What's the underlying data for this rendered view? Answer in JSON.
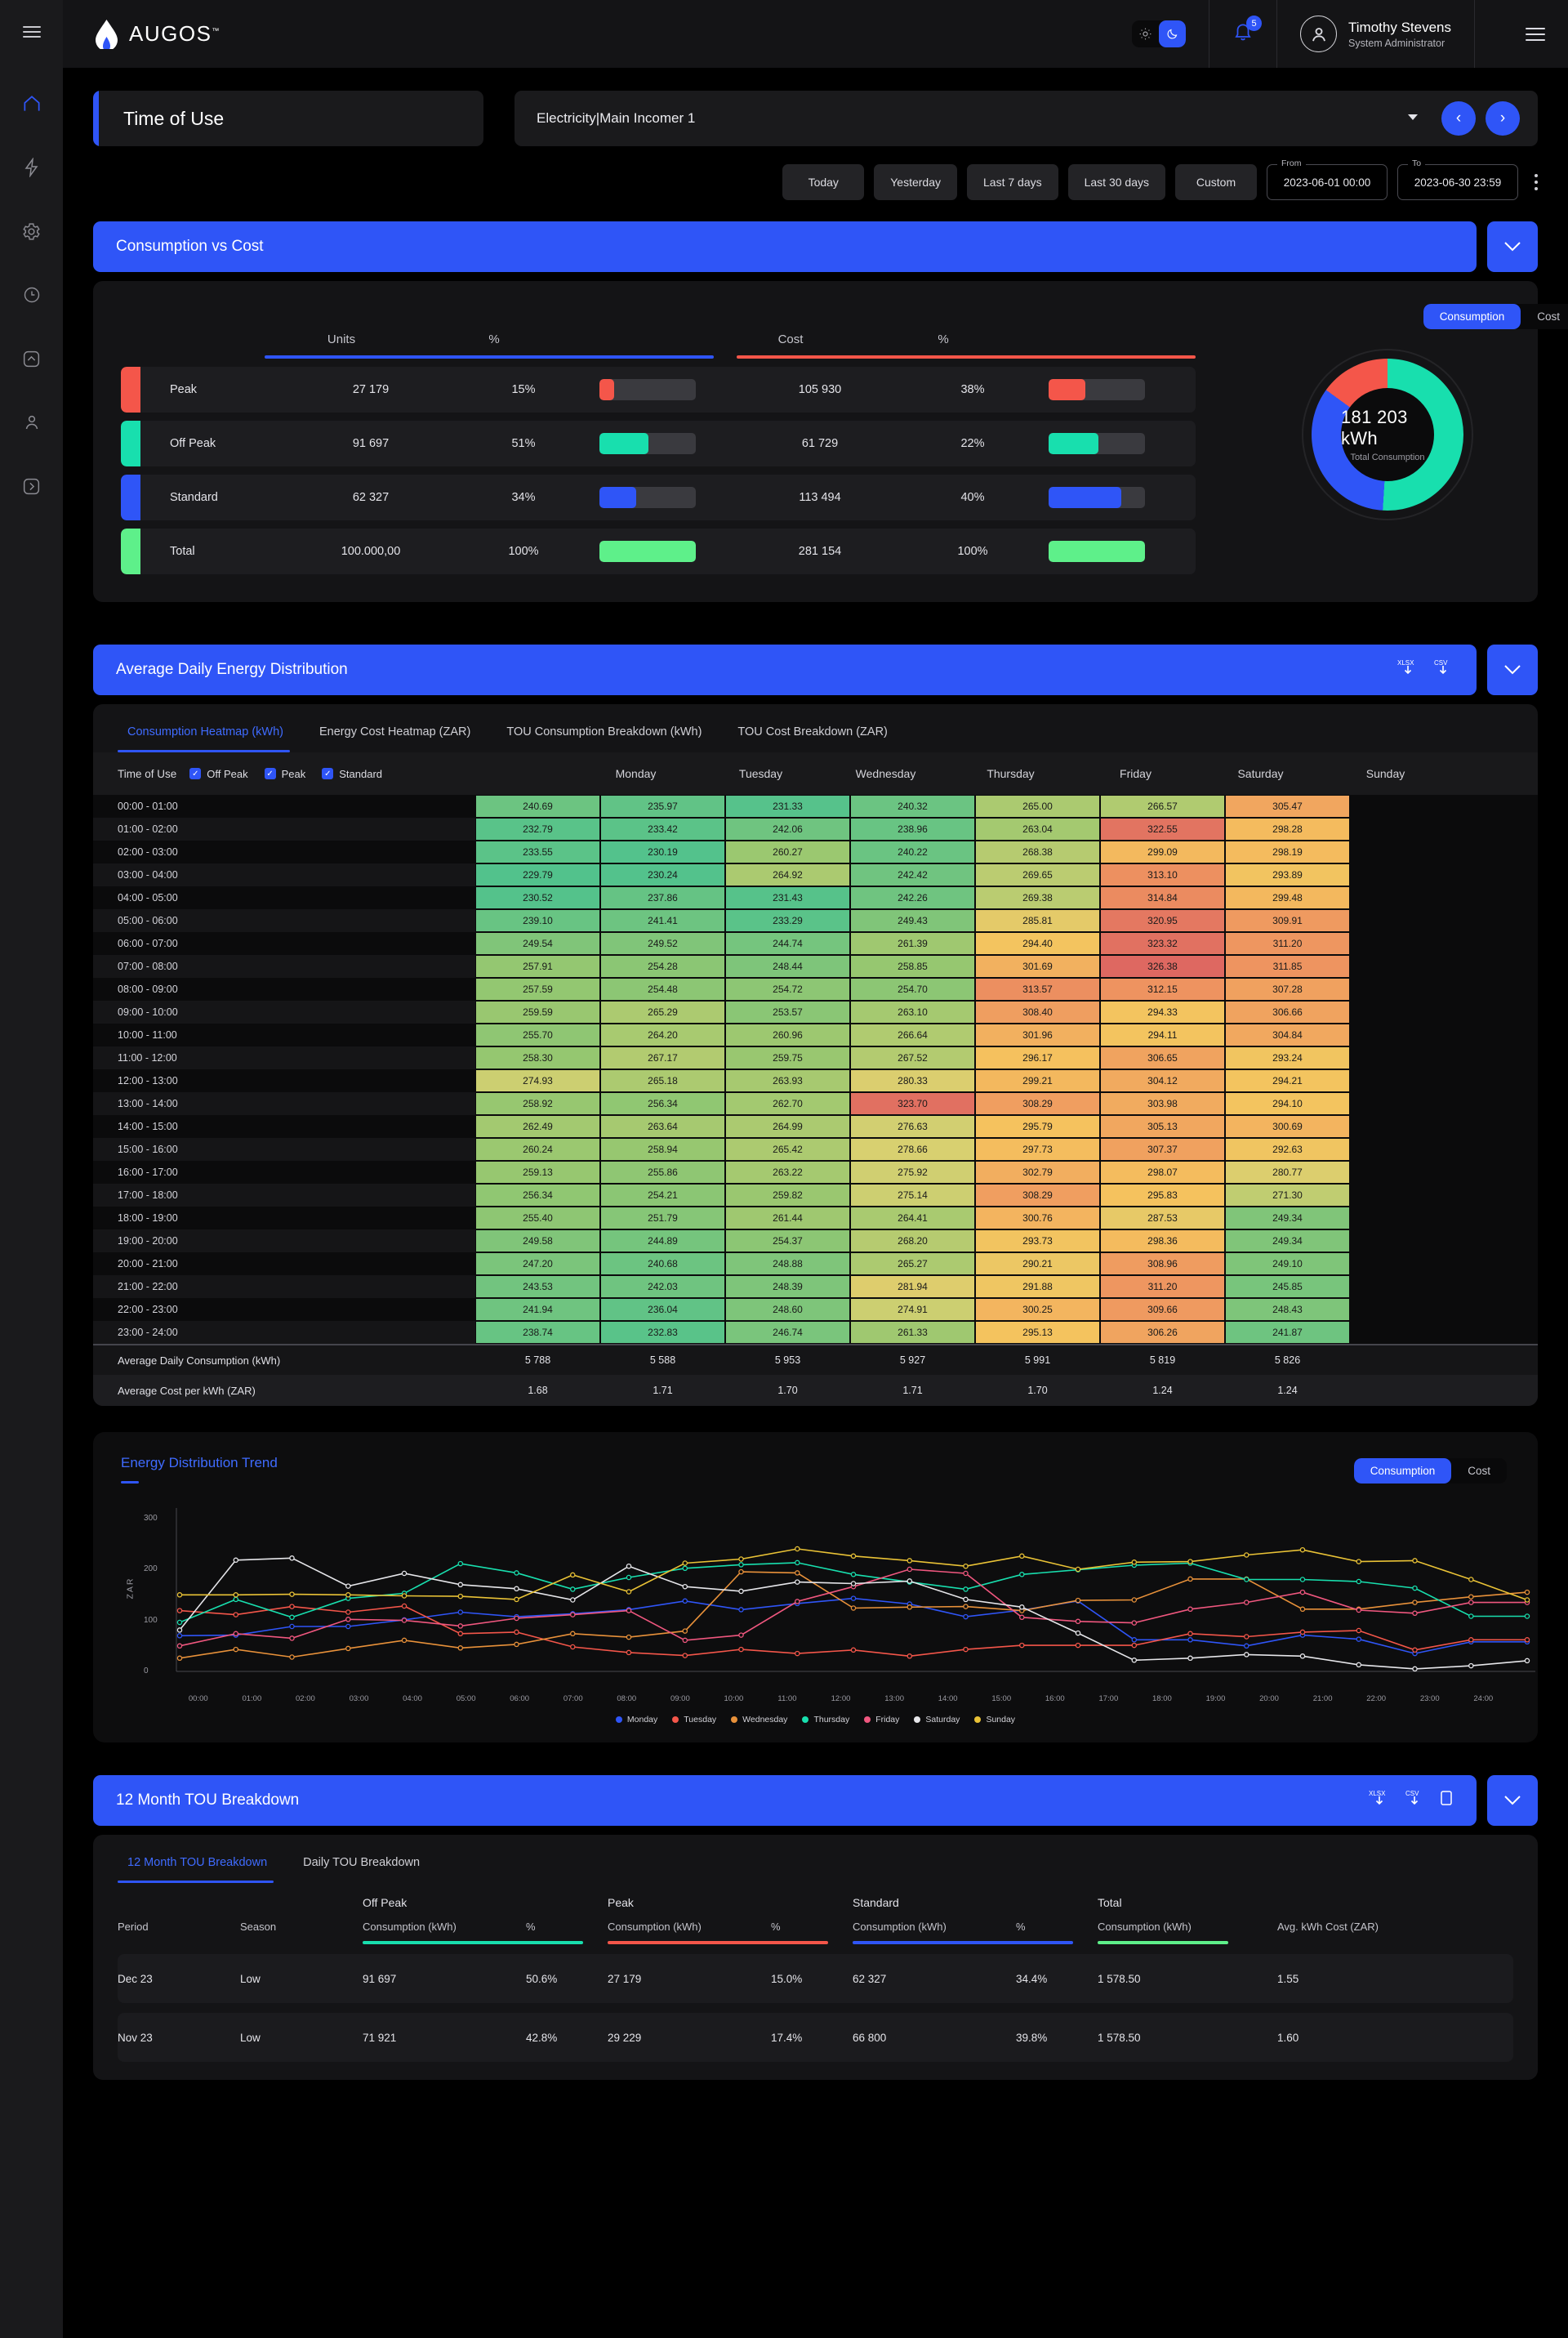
{
  "brand": {
    "name": "AUGOS",
    "tm": "™"
  },
  "topbar": {
    "theme_light_icon": "sun-icon",
    "theme_dark_icon": "moon-icon",
    "notifications_count": "5",
    "user_name": "Timothy Stevens",
    "user_role": "System Administrator"
  },
  "header": {
    "page_title": "Time of Use",
    "selector_value": "Electricity|Main Incomer 1",
    "prev_label": "‹",
    "next_label": "›"
  },
  "date_range": {
    "presets": [
      "Today",
      "Yesterday",
      "Last 7 days",
      "Last 30 days",
      "Custom"
    ],
    "from_label": "From",
    "from_value": "2023-06-01  00:00",
    "to_label": "To",
    "to_value": "2023-06-30  23:59"
  },
  "consumption_vs_cost": {
    "section_title": "Consumption vs Cost",
    "headers": {
      "units": "Units",
      "units_pct": "%",
      "cost": "Cost",
      "cost_pct": "%"
    },
    "toggle": {
      "consumption": "Consumption",
      "cost": "Cost",
      "selected": "Consumption"
    },
    "rows": [
      {
        "name": "Peak",
        "units": "27 179",
        "units_pct": "15%",
        "units_bar": 15,
        "cost": "105 930",
        "cost_pct": "38%",
        "cost_bar": 38,
        "color": "#f4564a"
      },
      {
        "name": "Off Peak",
        "units": "91 697",
        "units_pct": "51%",
        "units_bar": 51,
        "cost": "61 729",
        "cost_pct": "22%",
        "cost_bar": 52,
        "color": "#18dfae"
      },
      {
        "name": "Standard",
        "units": "62 327",
        "units_pct": "34%",
        "units_bar": 38,
        "cost": "113 494",
        "cost_pct": "40%",
        "cost_bar": 75,
        "color": "#2f55f7"
      },
      {
        "name": "Total",
        "units": "100.000,00",
        "units_pct": "100%",
        "units_bar": 100,
        "cost": "281 154",
        "cost_pct": "100%",
        "cost_bar": 100,
        "color": "#5ef08a"
      }
    ],
    "donut": {
      "center_value": "181 203 kWh",
      "center_label": "Total Consumption",
      "segments": [
        {
          "name": "Off Peak",
          "pct": 51,
          "color": "#18dfae"
        },
        {
          "name": "Standard",
          "pct": 34,
          "color": "#2f55f7"
        },
        {
          "name": "Peak",
          "pct": 15,
          "color": "#f4564a"
        }
      ]
    }
  },
  "heatmap_section": {
    "section_title": "Average Daily Energy Distribution",
    "export_xlsx": "XLSX",
    "export_csv": "CSV",
    "tabs": [
      "Consumption Heatmap (kWh)",
      "Energy Cost Heatmap (ZAR)",
      "TOU Consumption Breakdown (kWh)",
      "TOU Cost Breakdown (ZAR)"
    ],
    "active_tab": "Consumption Heatmap (kWh)",
    "tou_filter_label": "Time of Use",
    "tou_filters": [
      "Off Peak",
      "Peak",
      "Standard"
    ],
    "days": [
      "Monday",
      "Tuesday",
      "Wednesday",
      "Thursday",
      "Friday",
      "Saturday",
      "Sunday"
    ],
    "rows": [
      {
        "time": "00:00 - 01:00",
        "values": [
          "240.69",
          "235.97",
          "231.33",
          "240.32",
          "265.00",
          "266.57",
          "305.47"
        ]
      },
      {
        "time": "01:00 - 02:00",
        "values": [
          "232.79",
          "233.42",
          "242.06",
          "238.96",
          "263.04",
          "322.55",
          "298.28"
        ]
      },
      {
        "time": "02:00 - 03:00",
        "values": [
          "233.55",
          "230.19",
          "260.27",
          "240.22",
          "268.38",
          "299.09",
          "298.19"
        ]
      },
      {
        "time": "03:00 - 04:00",
        "values": [
          "229.79",
          "230.24",
          "264.92",
          "242.42",
          "269.65",
          "313.10",
          "293.89"
        ]
      },
      {
        "time": "04:00 - 05:00",
        "values": [
          "230.52",
          "237.86",
          "231.43",
          "242.26",
          "269.38",
          "314.84",
          "299.48"
        ]
      },
      {
        "time": "05:00 - 06:00",
        "values": [
          "239.10",
          "241.41",
          "233.29",
          "249.43",
          "285.81",
          "320.95",
          "309.91"
        ]
      },
      {
        "time": "06:00 - 07:00",
        "values": [
          "249.54",
          "249.52",
          "244.74",
          "261.39",
          "294.40",
          "323.32",
          "311.20"
        ]
      },
      {
        "time": "07:00 - 08:00",
        "values": [
          "257.91",
          "254.28",
          "248.44",
          "258.85",
          "301.69",
          "326.38",
          "311.85"
        ]
      },
      {
        "time": "08:00 - 09:00",
        "values": [
          "257.59",
          "254.48",
          "254.72",
          "254.70",
          "313.57",
          "312.15",
          "307.28"
        ]
      },
      {
        "time": "09:00 - 10:00",
        "values": [
          "259.59",
          "265.29",
          "253.57",
          "263.10",
          "308.40",
          "294.33",
          "306.66"
        ]
      },
      {
        "time": "10:00 - 11:00",
        "values": [
          "255.70",
          "264.20",
          "260.96",
          "266.64",
          "301.96",
          "294.11",
          "304.84"
        ]
      },
      {
        "time": "11:00 - 12:00",
        "values": [
          "258.30",
          "267.17",
          "259.75",
          "267.52",
          "296.17",
          "306.65",
          "293.24"
        ]
      },
      {
        "time": "12:00 - 13:00",
        "values": [
          "274.93",
          "265.18",
          "263.93",
          "280.33",
          "299.21",
          "304.12",
          "294.21"
        ]
      },
      {
        "time": "13:00 - 14:00",
        "values": [
          "258.92",
          "256.34",
          "262.70",
          "323.70",
          "308.29",
          "303.98",
          "294.10"
        ]
      },
      {
        "time": "14:00 - 15:00",
        "values": [
          "262.49",
          "263.64",
          "264.99",
          "276.63",
          "295.79",
          "305.13",
          "300.69"
        ]
      },
      {
        "time": "15:00 - 16:00",
        "values": [
          "260.24",
          "258.94",
          "265.42",
          "278.66",
          "297.73",
          "307.37",
          "292.63"
        ]
      },
      {
        "time": "16:00 - 17:00",
        "values": [
          "259.13",
          "255.86",
          "263.22",
          "275.92",
          "302.79",
          "298.07",
          "280.77"
        ]
      },
      {
        "time": "17:00 - 18:00",
        "values": [
          "256.34",
          "254.21",
          "259.82",
          "275.14",
          "308.29",
          "295.83",
          "271.30"
        ]
      },
      {
        "time": "18:00 - 19:00",
        "values": [
          "255.40",
          "251.79",
          "261.44",
          "264.41",
          "300.76",
          "287.53",
          "249.34"
        ]
      },
      {
        "time": "19:00 - 20:00",
        "values": [
          "249.58",
          "244.89",
          "254.37",
          "268.20",
          "293.73",
          "298.36",
          "249.34"
        ]
      },
      {
        "time": "20:00 - 21:00",
        "values": [
          "247.20",
          "240.68",
          "248.88",
          "265.27",
          "290.21",
          "308.96",
          "249.10"
        ]
      },
      {
        "time": "21:00 - 22:00",
        "values": [
          "243.53",
          "242.03",
          "248.39",
          "281.94",
          "291.88",
          "311.20",
          "245.85"
        ]
      },
      {
        "time": "22:00 - 23:00",
        "values": [
          "241.94",
          "236.04",
          "248.60",
          "274.91",
          "300.25",
          "309.66",
          "248.43"
        ]
      },
      {
        "time": "23:00 - 24:00",
        "values": [
          "238.74",
          "232.83",
          "246.74",
          "261.33",
          "295.13",
          "306.26",
          "241.87"
        ]
      }
    ],
    "summary": [
      {
        "label": "Average Daily Consumption (kWh)",
        "values": [
          "5 788",
          "5 588",
          "5 953",
          "5 927",
          "5 991",
          "5 819",
          "5 826"
        ]
      },
      {
        "label": "Average Cost per kWh (ZAR)",
        "values": [
          "1.68",
          "1.71",
          "1.70",
          "1.71",
          "1.70",
          "1.24",
          "1.24"
        ]
      }
    ]
  },
  "chart_data": {
    "type": "line",
    "title": "Energy Distribution Trend",
    "xlabel": "",
    "ylabel": "ZAR",
    "ylim": [
      0,
      320
    ],
    "yticks": [
      0,
      100,
      200,
      300
    ],
    "grid": false,
    "legend_position": "bottom",
    "toggle": {
      "consumption": "Consumption",
      "cost": "Cost",
      "selected": "Consumption"
    },
    "x": [
      "00:00",
      "01:00",
      "02:00",
      "03:00",
      "04:00",
      "05:00",
      "06:00",
      "07:00",
      "08:00",
      "09:00",
      "10:00",
      "11:00",
      "12:00",
      "13:00",
      "14:00",
      "15:00",
      "16:00",
      "17:00",
      "18:00",
      "19:00",
      "20:00",
      "21:00",
      "22:00",
      "23:00",
      "24:00"
    ],
    "series": [
      {
        "name": "Monday",
        "color": "#2f55f7",
        "values": [
          70,
          71,
          88,
          88,
          101,
          116,
          107,
          113,
          121,
          138,
          121,
          133,
          143,
          132,
          107,
          120,
          138,
          62,
          62,
          50,
          71,
          63,
          35,
          58,
          58
        ]
      },
      {
        "name": "Tuesday",
        "color": "#f4564a",
        "values": [
          119,
          111,
          127,
          116,
          128,
          74,
          77,
          48,
          37,
          31,
          43,
          35,
          42,
          30,
          43,
          51,
          51,
          51,
          74,
          68,
          77,
          80,
          42,
          62,
          62
        ]
      },
      {
        "name": "Wednesday",
        "color": "#e8913a",
        "values": [
          26,
          43,
          28,
          45,
          61,
          46,
          53,
          74,
          67,
          79,
          195,
          193,
          124,
          126,
          127,
          119,
          139,
          140,
          181,
          181,
          122,
          122,
          135,
          146,
          155
        ]
      },
      {
        "name": "Thursday",
        "color": "#18dfae",
        "values": [
          96,
          141,
          106,
          143,
          153,
          211,
          193,
          161,
          184,
          202,
          209,
          213,
          190,
          175,
          161,
          190,
          199,
          208,
          212,
          180,
          180,
          176,
          163,
          108,
          108
        ]
      },
      {
        "name": "Friday",
        "color": "#f0577f",
        "values": [
          50,
          74,
          65,
          102,
          100,
          89,
          104,
          111,
          119,
          61,
          71,
          137,
          166,
          200,
          192,
          106,
          98,
          95,
          122,
          135,
          155,
          120,
          114,
          135,
          135
        ]
      },
      {
        "name": "Saturday",
        "color": "#e6e6ea",
        "values": [
          81,
          218,
          222,
          167,
          192,
          170,
          162,
          140,
          206,
          166,
          157,
          175,
          172,
          177,
          141,
          126,
          75,
          22,
          26,
          33,
          30,
          13,
          5,
          11,
          21
        ]
      },
      {
        "name": "Sunday",
        "color": "#e9c236",
        "values": [
          150,
          150,
          151,
          150,
          148,
          147,
          141,
          189,
          156,
          212,
          220,
          240,
          226,
          217,
          206,
          226,
          200,
          214,
          215,
          228,
          238,
          215,
          217,
          180,
          140
        ]
      }
    ]
  },
  "tou_breakdown": {
    "section_title": "12 Month TOU Breakdown",
    "export_xlsx": "XLSX",
    "export_csv": "CSV",
    "copy_icon": "copy-icon",
    "tabs": [
      "12 Month TOU Breakdown",
      "Daily TOU Breakdown"
    ],
    "active_tab": "12 Month TOU Breakdown",
    "groups": [
      {
        "name": "Off Peak",
        "color": "#18dfae"
      },
      {
        "name": "Peak",
        "color": "#f4564a"
      },
      {
        "name": "Standard",
        "color": "#2f55f7"
      },
      {
        "name": "Total",
        "color": "#5ef08a"
      }
    ],
    "columns": {
      "period": "Period",
      "season": "Season",
      "offpeak_cons": "Consumption (kWh)",
      "offpeak_pct": "%",
      "peak_cons": "Consumption (kWh)",
      "peak_pct": "%",
      "standard_cons": "Consumption (kWh)",
      "standard_pct": "%",
      "total_cons": "Consumption (kWh)",
      "avg_cost": "Avg. kWh Cost (ZAR)"
    },
    "rows": [
      {
        "period": "Dec 23",
        "season": "Low",
        "offpeak_cons": "91 697",
        "offpeak_pct": "50.6%",
        "peak_cons": "27 179",
        "peak_pct": "15.0%",
        "standard_cons": "62 327",
        "standard_pct": "34.4%",
        "total_cons": "1 578.50",
        "avg_cost": "1.55"
      },
      {
        "period": "Nov 23",
        "season": "Low",
        "offpeak_cons": "71 921",
        "offpeak_pct": "42.8%",
        "peak_cons": "29 229",
        "peak_pct": "17.4%",
        "standard_cons": "66 800",
        "standard_pct": "39.8%",
        "total_cons": "1 578.50",
        "avg_cost": "1.60"
      }
    ]
  }
}
